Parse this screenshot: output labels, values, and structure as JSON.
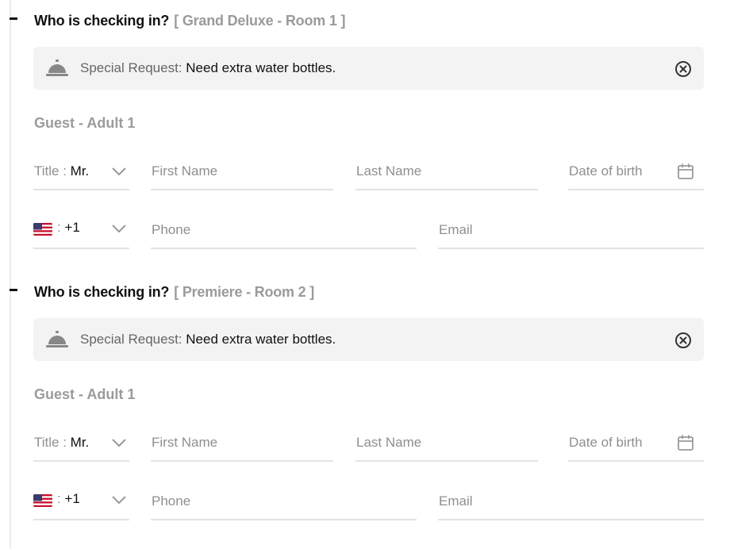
{
  "sections": [
    {
      "heading": "Who is checking in?",
      "room": "[ Grand Deluxe - Room 1 ]",
      "special_request_label": "Special Request:",
      "special_request_value": "Need extra water bottles.",
      "guest_label": "Guest - Adult 1",
      "title_label": "Title :",
      "title_value": "Mr.",
      "first_name_placeholder": "First Name",
      "last_name_placeholder": "Last Name",
      "dob_placeholder": "Date of birth",
      "phone_code_prefix": ":",
      "phone_code": "+1",
      "phone_placeholder": "Phone",
      "email_placeholder": "Email"
    },
    {
      "heading": "Who is checking in?",
      "room": "[ Premiere - Room 2 ]",
      "special_request_label": "Special Request:",
      "special_request_value": "Need extra water bottles.",
      "guest_label": "Guest - Adult 1",
      "title_label": "Title :",
      "title_value": "Mr.",
      "first_name_placeholder": "First Name",
      "last_name_placeholder": "Last Name",
      "dob_placeholder": "Date of birth",
      "phone_code_prefix": ":",
      "phone_code": "+1",
      "phone_placeholder": "Phone",
      "email_placeholder": "Email"
    }
  ],
  "icons": {
    "bell": "service-bell-icon",
    "clear": "close-circle-icon",
    "chevron": "chevron-down-icon",
    "calendar": "calendar-icon",
    "flag": "us-flag-icon"
  },
  "colors": {
    "muted_text": "#8f8f8f",
    "request_bg": "#f3f3f3",
    "underline": "#e3e3e3"
  }
}
